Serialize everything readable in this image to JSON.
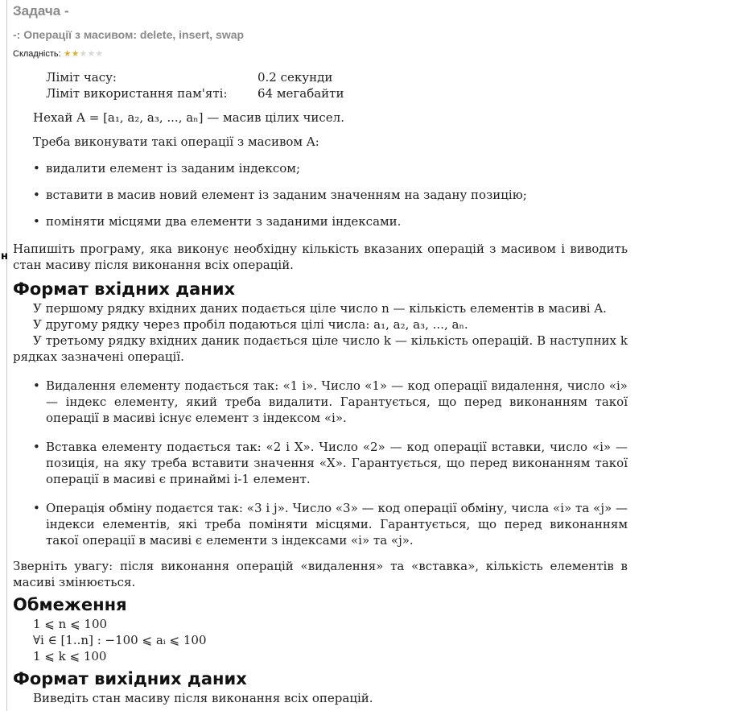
{
  "header": {
    "title": "Задача -",
    "subtitle": "-: Операції з масивом: delete, insert, swap",
    "difficulty_label": "Складність:",
    "difficulty": {
      "filled": 2,
      "total": 5
    }
  },
  "limits": [
    {
      "label": "Ліміт часу:",
      "value": "0.2 секунди"
    },
    {
      "label": "Ліміт використання пам'яті:",
      "value": "64 мегабайти"
    }
  ],
  "stray_char": "н",
  "statement": {
    "p1": "Нехай A = [a₁, a₂, a₃, ..., aₙ] — масив цілих чисел.",
    "p2": "Треба виконувати такі операції з масивом A:",
    "ops": [
      "видалити елемент із заданим індексом;",
      "вставити в масив новий елемент із заданим значенням на задану позицію;",
      "поміняти місцями два елементи з заданими індексами."
    ],
    "p3": "Напишіть програму, яка виконує необхідну кількість вказаних операцій з масивом і виводить стан масиву після виконання всіх операцій."
  },
  "input_format": {
    "heading": "Формат вхідних даних",
    "line1": "У першому рядку вхідних даних подається ціле число n — кількість елементів в масиві A.",
    "line2": "У другому рядку через пробіл подаються цілі числа: a₁, a₂, a₃, ..., aₙ.",
    "line3": "У третьому рядку вхідних даник подається ціле число k — кількість операцій. В наступних k рядках зазначені операції.",
    "items": [
      "Видалення елементу подається так: «1 i». Число «1» — код операції видалення, число «i» — індекс елементу, який треба видалити. Гарантується, що перед виконанням такої операції в масиві існує елемент з індексом «i».",
      "Вставка елементу подається так: «2 i X». Число «2» — код операції вставки, число «i» — позиція, на яку треба вставити значення «X». Гарантується, що перед виконанням такої операції в масиві є принаймі i-1 елемент.",
      "Операція обміну подаєтся так: «3 i j». Число «3» — код операції обміну, числа «i» та «j» — індекси елементів, які треба поміняти місцями. Гарантується, що перед виконанням такої операції в масиві є елементи з індексами «i» та «j»."
    ],
    "note": "Зверніть увагу: після виконання операцій «видалення» та «вставка», кількість елементів в масиві змінюється."
  },
  "constraints": {
    "heading": "Обмеження",
    "lines": [
      "1 ⩽ n ⩽ 100",
      "∀i ∈ [1..n] : −100 ⩽ aᵢ ⩽ 100",
      "1 ⩽ k ⩽ 100"
    ]
  },
  "output_format": {
    "heading": "Формат вихідних даних",
    "text": "Виведіть стан масиву після виконання всіх операцій."
  }
}
